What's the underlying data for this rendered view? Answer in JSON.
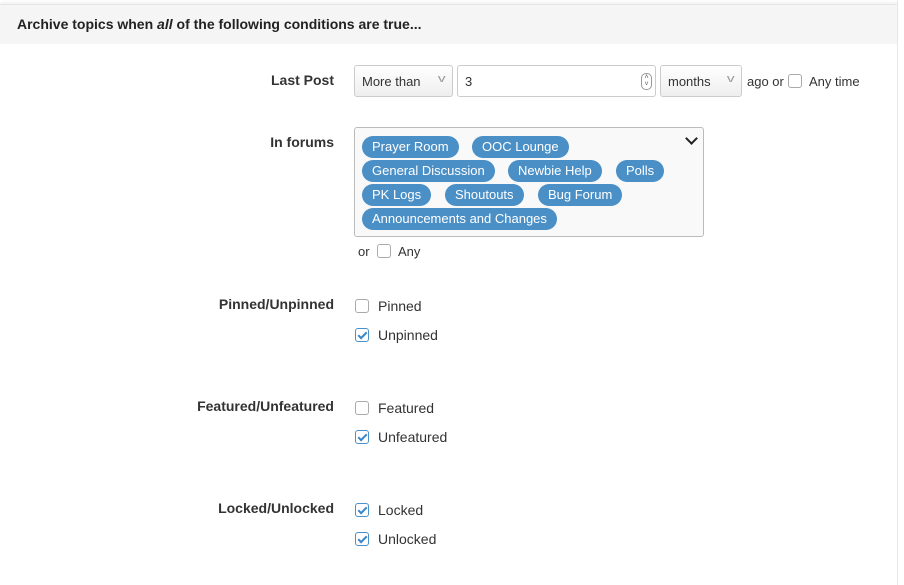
{
  "header": {
    "title_pre": "Archive topics when ",
    "title_em": "all",
    "title_post": " of the following conditions are true..."
  },
  "last_post": {
    "label": "Last Post",
    "comparison": "More than",
    "amount": "3",
    "unit": "months",
    "suffix": "ago or",
    "any_time_label": "Any time",
    "any_time_checked": false
  },
  "forums": {
    "label": "In forums",
    "selected": [
      "Prayer Room",
      "OOC Lounge",
      "General Discussion",
      "Newbie Help",
      "Polls",
      "PK Logs",
      "Shoutouts",
      "Bug Forum",
      "Announcements and Changes"
    ],
    "or_label": "or",
    "any_label": "Any",
    "any_checked": false
  },
  "groups": [
    {
      "label": "Pinned/Unpinned",
      "options": [
        {
          "label": "Pinned",
          "checked": false
        },
        {
          "label": "Unpinned",
          "checked": true
        }
      ]
    },
    {
      "label": "Featured/Unfeatured",
      "options": [
        {
          "label": "Featured",
          "checked": false
        },
        {
          "label": "Unfeatured",
          "checked": true
        }
      ]
    },
    {
      "label": "Locked/Unlocked",
      "options": [
        {
          "label": "Locked",
          "checked": true
        },
        {
          "label": "Unlocked",
          "checked": true
        }
      ]
    }
  ],
  "colors": {
    "pill": "#4a8fc6",
    "check": "#3a86c8"
  }
}
